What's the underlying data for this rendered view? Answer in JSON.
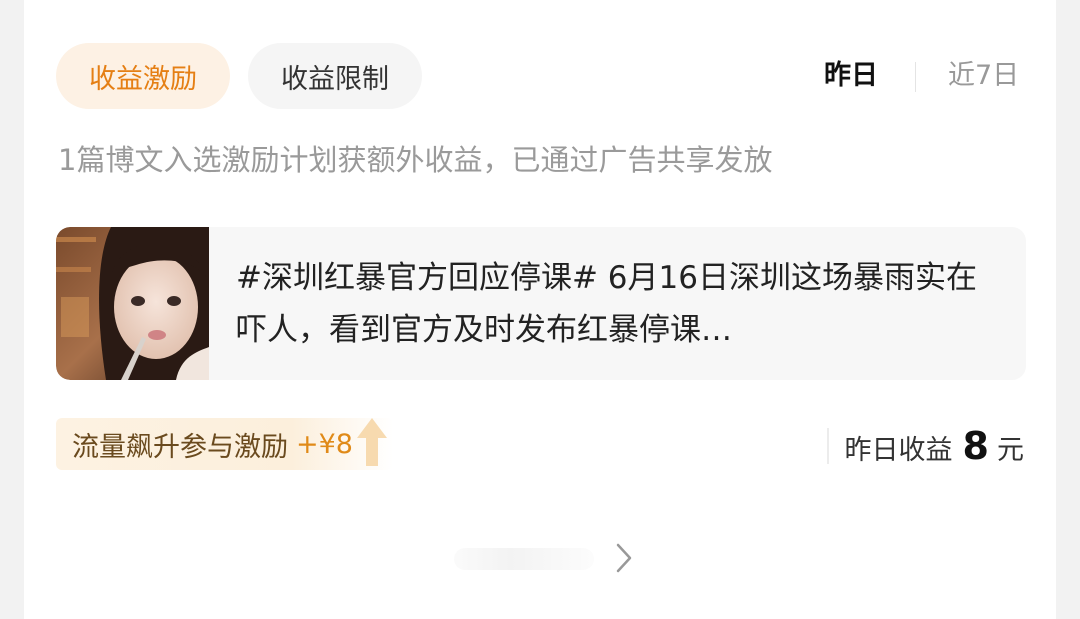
{
  "tabs": [
    {
      "label": "收益激励",
      "active": true
    },
    {
      "label": "收益限制",
      "active": false
    }
  ],
  "period": {
    "yesterday": "昨日",
    "last7": "近7日",
    "selected": "昨日"
  },
  "subtitle": "1篇博文入选激励计划获额外收益，已通过广告共享发放",
  "post": {
    "text": "#深圳红暴官方回应停课# 6月16日深圳这场暴雨实在吓人，看到官方及时发布红暴停课…"
  },
  "boost": {
    "label": "流量飙升参与激励",
    "amount": "+¥8"
  },
  "earning": {
    "label": "昨日收益",
    "value": "8",
    "unit": "元"
  },
  "colors": {
    "accent": "#e57f14",
    "accent_bg": "#fdf1e4"
  }
}
